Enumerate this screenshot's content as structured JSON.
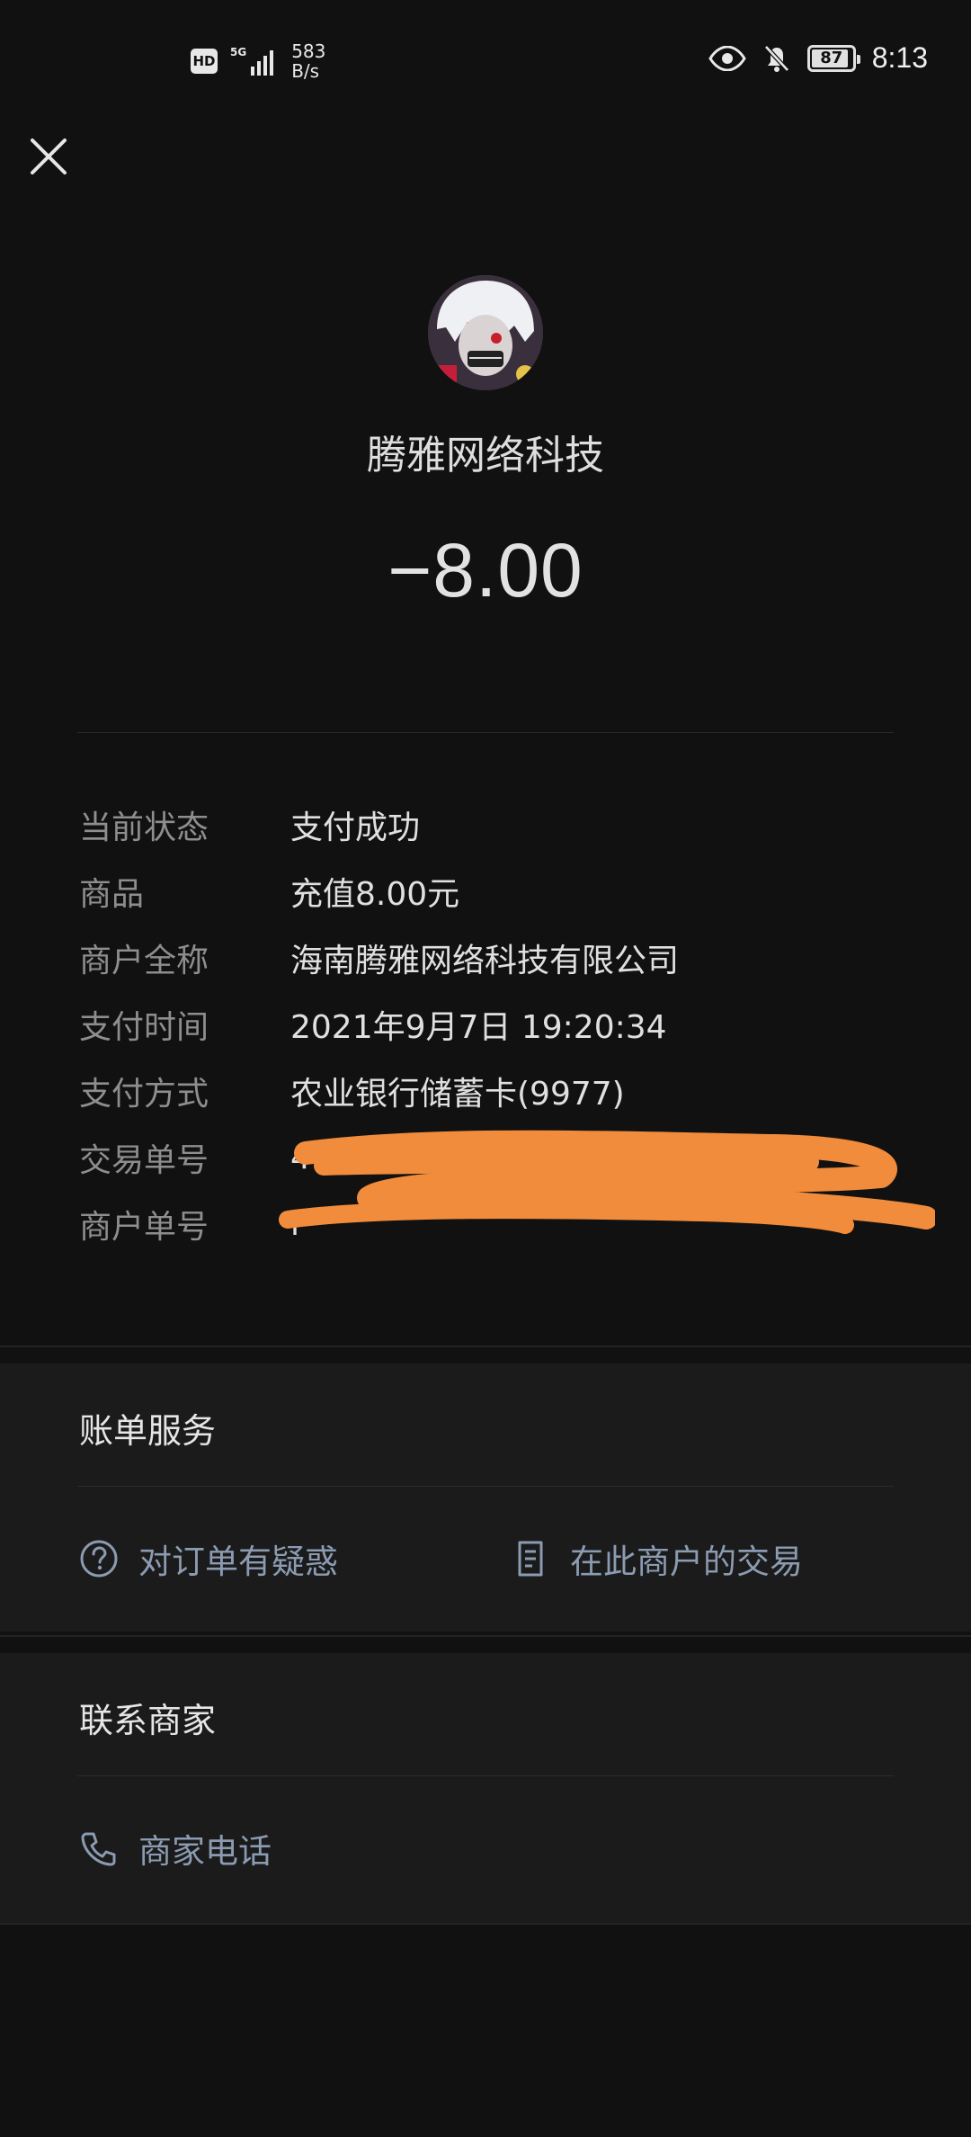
{
  "status_bar": {
    "hd_label": "HD",
    "network_type": "5G",
    "net_speed_value": "583",
    "net_speed_unit": "B/s",
    "battery_level": "87",
    "time": "8:13"
  },
  "merchant": {
    "name": "腾雅网络科技",
    "amount": "−8.00"
  },
  "details": [
    {
      "label": "当前状态",
      "value": "支付成功"
    },
    {
      "label": "商品",
      "value": "充值8.00元"
    },
    {
      "label": "商户全称",
      "value": "海南腾雅网络科技有限公司"
    },
    {
      "label": "支付时间",
      "value": "2021年9月7日 19:20:34"
    },
    {
      "label": "支付方式",
      "value": "农业银行储蓄卡(9977)"
    },
    {
      "label": "交易单号",
      "value": "4"
    },
    {
      "label": "商户单号",
      "value": "i"
    }
  ],
  "bill_service": {
    "title": "账单服务",
    "question_link": "对订单有疑惑",
    "merchant_tx_link": "在此商户的交易"
  },
  "contact": {
    "title": "联系商家",
    "phone_link": "商家电话"
  },
  "colors": {
    "background": "#111111",
    "card": "#1b1b1b",
    "link": "#8b9bb1",
    "redaction": "#f08c3c"
  }
}
